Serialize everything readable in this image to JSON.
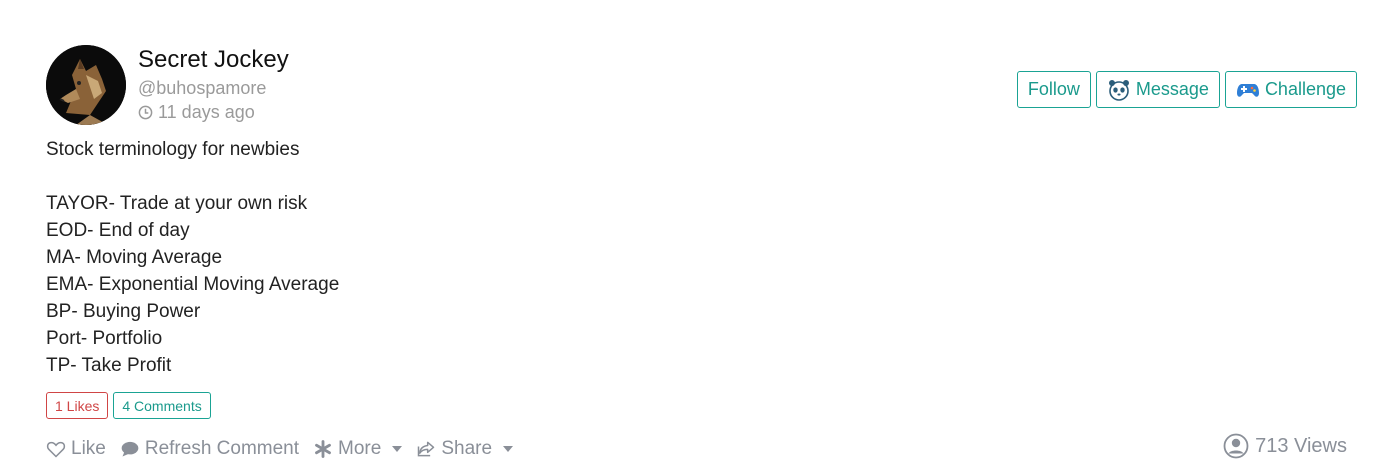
{
  "author": {
    "name": "Secret Jockey",
    "handle": "@buhospamore",
    "time": "11 days ago",
    "avatar_icon": "wolf-avatar"
  },
  "actions": {
    "follow_label": "Follow",
    "message_label": "Message",
    "challenge_label": "Challenge"
  },
  "post": {
    "title": "Stock terminology for newbies",
    "lines": [
      "TAYOR- Trade at your own risk",
      "EOD- End of day",
      "MA- Moving Average",
      "EMA- Exponential Moving Average",
      "BP- Buying Power",
      "Port- Portfolio",
      "TP- Take Profit"
    ]
  },
  "badges": {
    "likes": "1 Likes",
    "comments": "4 Comments"
  },
  "toolbar": {
    "like_label": "Like",
    "refresh_label": "Refresh Comment",
    "more_label": "More",
    "share_label": "Share"
  },
  "stats": {
    "views": "713 Views"
  },
  "colors": {
    "accent": "#1aa394",
    "likes": "#d04545",
    "muted": "#8a8f98"
  }
}
